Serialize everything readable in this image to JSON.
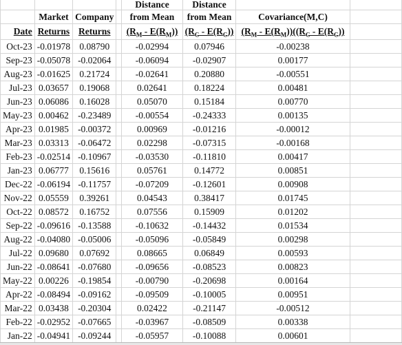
{
  "headers": {
    "row1": {
      "dist_m": "Distance",
      "dist_c": "Distance"
    },
    "row2": {
      "market": "Market",
      "company": "Company",
      "dist_m": "from Mean",
      "dist_c": "from Mean",
      "cov": "Covariance(M,C)"
    },
    "row3": {
      "date": "Date",
      "market": "Returns",
      "company": "Returns",
      "dist_m": [
        "(R",
        "M",
        " - E(R",
        "M",
        "))"
      ],
      "dist_c": [
        "(R",
        "C",
        " - E(R",
        "C",
        "))"
      ],
      "cov": [
        "(R",
        "M",
        " - E(R",
        "M",
        "))((R",
        "C",
        " - E(R",
        "C",
        "))"
      ]
    }
  },
  "rows": [
    [
      "Oct-23",
      "-0.01978",
      "0.08790",
      "-0.02994",
      "0.07946",
      "-0.00238"
    ],
    [
      "Sep-23",
      "-0.05078",
      "-0.02064",
      "-0.06094",
      "-0.02907",
      "0.00177"
    ],
    [
      "Aug-23",
      "-0.01625",
      "0.21724",
      "-0.02641",
      "0.20880",
      "-0.00551"
    ],
    [
      "Jul-23",
      "0.03657",
      "0.19068",
      "0.02641",
      "0.18224",
      "0.00481"
    ],
    [
      "Jun-23",
      "0.06086",
      "0.16028",
      "0.05070",
      "0.15184",
      "0.00770"
    ],
    [
      "May-23",
      "0.00462",
      "-0.23489",
      "-0.00554",
      "-0.24333",
      "0.00135"
    ],
    [
      "Apr-23",
      "0.01985",
      "-0.00372",
      "0.00969",
      "-0.01216",
      "-0.00012"
    ],
    [
      "Mar-23",
      "0.03313",
      "-0.06472",
      "0.02298",
      "-0.07315",
      "-0.00168"
    ],
    [
      "Feb-23",
      "-0.02514",
      "-0.10967",
      "-0.03530",
      "-0.11810",
      "0.00417"
    ],
    [
      "Jan-23",
      "0.06777",
      "0.15616",
      "0.05761",
      "0.14772",
      "0.00851"
    ],
    [
      "Dec-22",
      "-0.06194",
      "-0.11757",
      "-0.07209",
      "-0.12601",
      "0.00908"
    ],
    [
      "Nov-22",
      "0.05559",
      "0.39261",
      "0.04543",
      "0.38417",
      "0.01745"
    ],
    [
      "Oct-22",
      "0.08572",
      "0.16752",
      "0.07556",
      "0.15909",
      "0.01202"
    ],
    [
      "Sep-22",
      "-0.09616",
      "-0.13588",
      "-0.10632",
      "-0.14432",
      "0.01534"
    ],
    [
      "Aug-22",
      "-0.04080",
      "-0.05006",
      "-0.05096",
      "-0.05849",
      "0.00298"
    ],
    [
      "Jul-22",
      "0.09680",
      "0.07692",
      "0.08665",
      "0.06849",
      "0.00593"
    ],
    [
      "Jun-22",
      "-0.08641",
      "-0.07680",
      "-0.09656",
      "-0.08523",
      "0.00823"
    ],
    [
      "May-22",
      "0.00226",
      "-0.19854",
      "-0.00790",
      "-0.20698",
      "0.00164"
    ],
    [
      "Apr-22",
      "-0.08494",
      "-0.09162",
      "-0.09509",
      "-0.10005",
      "0.00951"
    ],
    [
      "Mar-22",
      "0.03438",
      "-0.20304",
      "0.02422",
      "-0.21147",
      "-0.00512"
    ],
    [
      "Feb-22",
      "-0.02952",
      "-0.07665",
      "-0.03967",
      "-0.08509",
      "0.00338"
    ],
    [
      "Jan-22",
      "-0.04941",
      "-0.09244",
      "-0.05957",
      "-0.10088",
      "0.00601"
    ]
  ]
}
